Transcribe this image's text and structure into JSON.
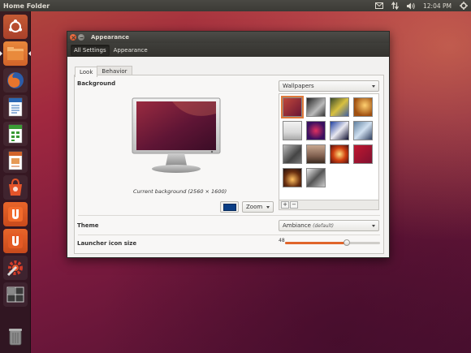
{
  "top_panel": {
    "title": "Home Folder",
    "clock": "12:04 PM",
    "icons": [
      "envelope-icon",
      "network-icon",
      "volume-icon",
      "gear-icon"
    ]
  },
  "launcher": {
    "items": [
      {
        "name": "dash-home-icon"
      },
      {
        "name": "files-icon"
      },
      {
        "name": "firefox-icon"
      },
      {
        "name": "writer-icon"
      },
      {
        "name": "calc-icon"
      },
      {
        "name": "impress-icon"
      },
      {
        "name": "software-center-icon"
      },
      {
        "name": "ubuntu-one-icon"
      },
      {
        "name": "ubuntu-one-music-icon"
      },
      {
        "name": "system-settings-icon"
      },
      {
        "name": "workspace-switcher-icon"
      },
      {
        "name": "trash-icon"
      }
    ]
  },
  "window": {
    "title": "Appearance",
    "toolbar": {
      "all_settings": "All Settings",
      "appearance": "Appearance"
    },
    "tabs": [
      {
        "label": "Look"
      },
      {
        "label": "Behavior"
      }
    ],
    "background_label": "Background",
    "wallpaper_source": "Wallpapers",
    "caption": "Current background (2560 × 1600)",
    "zoom": "Zoom",
    "color_hex": "#0b3e86",
    "add_label": "+",
    "remove_label": "−",
    "theme_label": "Theme",
    "theme_value": "Ambiance",
    "theme_suffix": "(default)",
    "launcher_label": "Launcher icon size",
    "launcher_value": "48",
    "launcher_fraction": 0.65
  }
}
